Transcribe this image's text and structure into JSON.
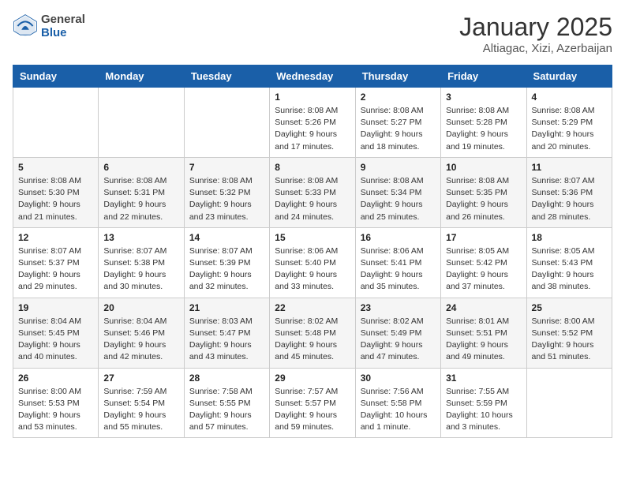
{
  "header": {
    "logo_general": "General",
    "logo_blue": "Blue",
    "month_title": "January 2025",
    "location": "Altiagac, Xizi, Azerbaijan"
  },
  "days_of_week": [
    "Sunday",
    "Monday",
    "Tuesday",
    "Wednesday",
    "Thursday",
    "Friday",
    "Saturday"
  ],
  "weeks": [
    [
      {
        "day": "",
        "info": ""
      },
      {
        "day": "",
        "info": ""
      },
      {
        "day": "",
        "info": ""
      },
      {
        "day": "1",
        "info": "Sunrise: 8:08 AM\nSunset: 5:26 PM\nDaylight: 9 hours\nand 17 minutes."
      },
      {
        "day": "2",
        "info": "Sunrise: 8:08 AM\nSunset: 5:27 PM\nDaylight: 9 hours\nand 18 minutes."
      },
      {
        "day": "3",
        "info": "Sunrise: 8:08 AM\nSunset: 5:28 PM\nDaylight: 9 hours\nand 19 minutes."
      },
      {
        "day": "4",
        "info": "Sunrise: 8:08 AM\nSunset: 5:29 PM\nDaylight: 9 hours\nand 20 minutes."
      }
    ],
    [
      {
        "day": "5",
        "info": "Sunrise: 8:08 AM\nSunset: 5:30 PM\nDaylight: 9 hours\nand 21 minutes."
      },
      {
        "day": "6",
        "info": "Sunrise: 8:08 AM\nSunset: 5:31 PM\nDaylight: 9 hours\nand 22 minutes."
      },
      {
        "day": "7",
        "info": "Sunrise: 8:08 AM\nSunset: 5:32 PM\nDaylight: 9 hours\nand 23 minutes."
      },
      {
        "day": "8",
        "info": "Sunrise: 8:08 AM\nSunset: 5:33 PM\nDaylight: 9 hours\nand 24 minutes."
      },
      {
        "day": "9",
        "info": "Sunrise: 8:08 AM\nSunset: 5:34 PM\nDaylight: 9 hours\nand 25 minutes."
      },
      {
        "day": "10",
        "info": "Sunrise: 8:08 AM\nSunset: 5:35 PM\nDaylight: 9 hours\nand 26 minutes."
      },
      {
        "day": "11",
        "info": "Sunrise: 8:07 AM\nSunset: 5:36 PM\nDaylight: 9 hours\nand 28 minutes."
      }
    ],
    [
      {
        "day": "12",
        "info": "Sunrise: 8:07 AM\nSunset: 5:37 PM\nDaylight: 9 hours\nand 29 minutes."
      },
      {
        "day": "13",
        "info": "Sunrise: 8:07 AM\nSunset: 5:38 PM\nDaylight: 9 hours\nand 30 minutes."
      },
      {
        "day": "14",
        "info": "Sunrise: 8:07 AM\nSunset: 5:39 PM\nDaylight: 9 hours\nand 32 minutes."
      },
      {
        "day": "15",
        "info": "Sunrise: 8:06 AM\nSunset: 5:40 PM\nDaylight: 9 hours\nand 33 minutes."
      },
      {
        "day": "16",
        "info": "Sunrise: 8:06 AM\nSunset: 5:41 PM\nDaylight: 9 hours\nand 35 minutes."
      },
      {
        "day": "17",
        "info": "Sunrise: 8:05 AM\nSunset: 5:42 PM\nDaylight: 9 hours\nand 37 minutes."
      },
      {
        "day": "18",
        "info": "Sunrise: 8:05 AM\nSunset: 5:43 PM\nDaylight: 9 hours\nand 38 minutes."
      }
    ],
    [
      {
        "day": "19",
        "info": "Sunrise: 8:04 AM\nSunset: 5:45 PM\nDaylight: 9 hours\nand 40 minutes."
      },
      {
        "day": "20",
        "info": "Sunrise: 8:04 AM\nSunset: 5:46 PM\nDaylight: 9 hours\nand 42 minutes."
      },
      {
        "day": "21",
        "info": "Sunrise: 8:03 AM\nSunset: 5:47 PM\nDaylight: 9 hours\nand 43 minutes."
      },
      {
        "day": "22",
        "info": "Sunrise: 8:02 AM\nSunset: 5:48 PM\nDaylight: 9 hours\nand 45 minutes."
      },
      {
        "day": "23",
        "info": "Sunrise: 8:02 AM\nSunset: 5:49 PM\nDaylight: 9 hours\nand 47 minutes."
      },
      {
        "day": "24",
        "info": "Sunrise: 8:01 AM\nSunset: 5:51 PM\nDaylight: 9 hours\nand 49 minutes."
      },
      {
        "day": "25",
        "info": "Sunrise: 8:00 AM\nSunset: 5:52 PM\nDaylight: 9 hours\nand 51 minutes."
      }
    ],
    [
      {
        "day": "26",
        "info": "Sunrise: 8:00 AM\nSunset: 5:53 PM\nDaylight: 9 hours\nand 53 minutes."
      },
      {
        "day": "27",
        "info": "Sunrise: 7:59 AM\nSunset: 5:54 PM\nDaylight: 9 hours\nand 55 minutes."
      },
      {
        "day": "28",
        "info": "Sunrise: 7:58 AM\nSunset: 5:55 PM\nDaylight: 9 hours\nand 57 minutes."
      },
      {
        "day": "29",
        "info": "Sunrise: 7:57 AM\nSunset: 5:57 PM\nDaylight: 9 hours\nand 59 minutes."
      },
      {
        "day": "30",
        "info": "Sunrise: 7:56 AM\nSunset: 5:58 PM\nDaylight: 10 hours\nand 1 minute."
      },
      {
        "day": "31",
        "info": "Sunrise: 7:55 AM\nSunset: 5:59 PM\nDaylight: 10 hours\nand 3 minutes."
      },
      {
        "day": "",
        "info": ""
      }
    ]
  ]
}
